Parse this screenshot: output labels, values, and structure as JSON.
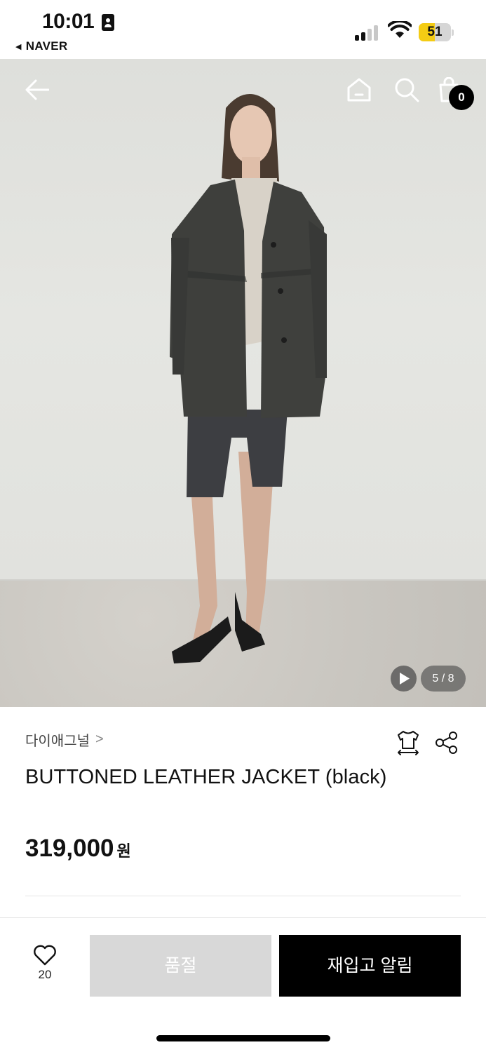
{
  "status_bar": {
    "time": "10:01",
    "back_app": "NAVER",
    "battery_percent": "51",
    "battery_level": 0.51,
    "colors": {
      "battery_fill": "#f4cc14"
    }
  },
  "header": {
    "icons": [
      "back-arrow-icon",
      "home-icon",
      "search-icon",
      "shopping-bag-icon"
    ],
    "cart_count": "0"
  },
  "gallery": {
    "counter": "5 / 8",
    "video_icon": "play-icon"
  },
  "product": {
    "brand": "다이애그널",
    "brand_chevron": ">",
    "name": "BUTTONED LEATHER JACKET (black)",
    "price": "319,000",
    "price_unit": "원",
    "action_icons": [
      "size-guide-shirt-icon",
      "share-icon"
    ]
  },
  "bottom_bar": {
    "like_count": "20",
    "soldout_label": "품절",
    "restock_label": "재입고 알림"
  }
}
